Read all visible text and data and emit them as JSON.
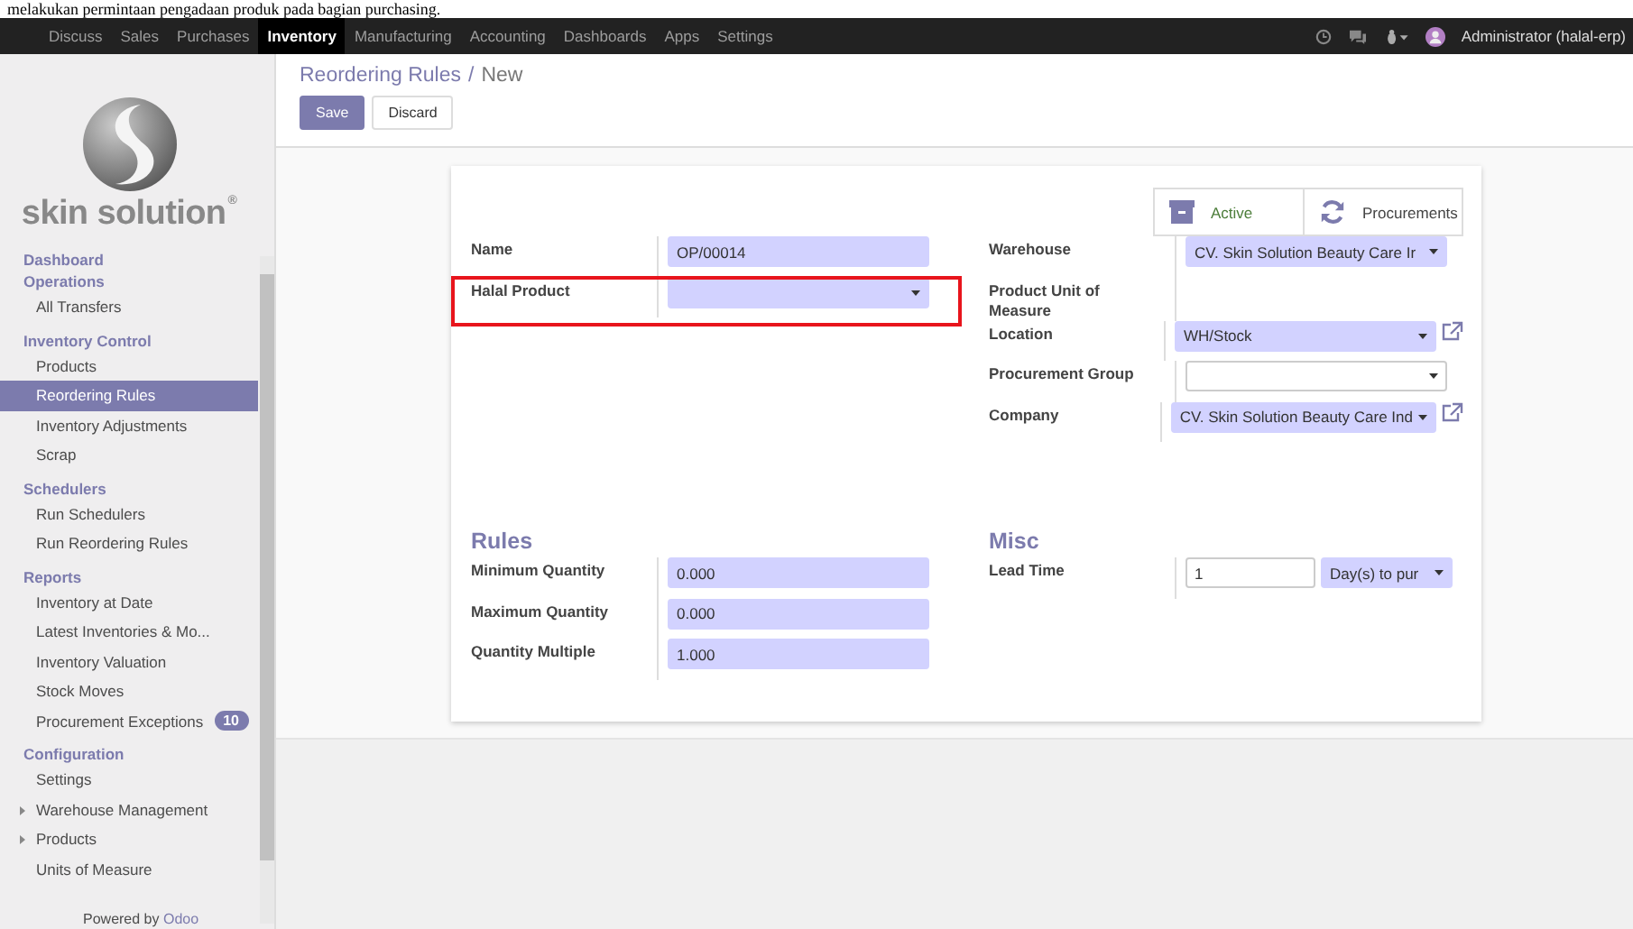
{
  "caption": "melakukan permintaan pengadaan produk pada bagian purchasing.",
  "navbar": {
    "menus": [
      {
        "label": "Discuss",
        "selected": false
      },
      {
        "label": "Sales",
        "selected": false
      },
      {
        "label": "Purchases",
        "selected": false
      },
      {
        "label": "Inventory",
        "selected": true
      },
      {
        "label": "Manufacturing",
        "selected": false
      },
      {
        "label": "Accounting",
        "selected": false
      },
      {
        "label": "Dashboards",
        "selected": false
      },
      {
        "label": "Apps",
        "selected": false
      },
      {
        "label": "Settings",
        "selected": false
      }
    ],
    "user": "Administrator (halal-erp)"
  },
  "sidebar": {
    "logo_text": "skin solution",
    "logo_mark": "®",
    "sections": [
      {
        "title": "Dashboard"
      },
      {
        "title": "Operations",
        "items": [
          {
            "label": "All Transfers",
            "selected": false
          }
        ]
      },
      {
        "title": "Inventory Control",
        "items": [
          {
            "label": "Products",
            "selected": false
          },
          {
            "label": "Reordering Rules",
            "selected": true
          },
          {
            "label": "Inventory Adjustments",
            "selected": false
          },
          {
            "label": "Scrap",
            "selected": false
          }
        ]
      },
      {
        "title": "Schedulers",
        "items": [
          {
            "label": "Run Schedulers",
            "selected": false
          },
          {
            "label": "Run Reordering Rules",
            "selected": false
          }
        ]
      },
      {
        "title": "Reports",
        "items": [
          {
            "label": "Inventory at Date",
            "selected": false
          },
          {
            "label": "Latest Inventories & Mo...",
            "selected": false
          },
          {
            "label": "Inventory Valuation",
            "selected": false
          },
          {
            "label": "Stock Moves",
            "selected": false
          },
          {
            "label": "Procurement Exceptions",
            "selected": false,
            "badge": "10"
          }
        ]
      },
      {
        "title": "Configuration",
        "items": [
          {
            "label": "Settings",
            "selected": false
          },
          {
            "label": "Warehouse Management",
            "selected": false,
            "expanded": false
          },
          {
            "label": "Products",
            "selected": false,
            "expanded": false
          },
          {
            "label": "Units of Measure",
            "selected": false
          }
        ]
      }
    ],
    "powered_by": "Powered by",
    "powered_link": "Odoo"
  },
  "control_panel": {
    "breadcrumb_parent": "Reordering Rules",
    "breadcrumb_separator": "/",
    "breadcrumb_current": "New",
    "buttons": [
      {
        "kind": "primary",
        "label": "Save"
      },
      {
        "kind": "secondary",
        "label": "Discard"
      }
    ]
  },
  "form": {
    "smart_buttons": [
      {
        "kind": "archive",
        "label": "Active"
      },
      {
        "kind": "refresh",
        "label": "Procurements"
      }
    ],
    "left_fields": [
      {
        "label": "Name",
        "kind": "text",
        "value": "OP/00014",
        "required": true,
        "highlighted": false
      },
      {
        "label": "Halal Product",
        "kind": "select",
        "required": true,
        "highlighted": true
      }
    ],
    "right_fields": [
      {
        "label": "Warehouse",
        "kind": "select",
        "value": "CV. Skin Solution Beauty Care Ir",
        "required": true,
        "external_link": false
      },
      {
        "label": "Product Unit of Measure",
        "kind": "readonly",
        "external_link": false
      },
      {
        "label": "Location",
        "kind": "select",
        "value": "WH/Stock",
        "required": true,
        "external_link": true
      },
      {
        "label": "Procurement Group",
        "kind": "select",
        "required": false,
        "external_link": false
      },
      {
        "label": "Company",
        "kind": "select",
        "value": "CV. Skin Solution Beauty Care Ind",
        "required": true,
        "external_link": true
      }
    ],
    "rules": {
      "title": "Rules",
      "fields": [
        {
          "label": "Minimum Quantity",
          "kind": "text",
          "value": "0.000",
          "required": true
        },
        {
          "label": "Maximum Quantity",
          "kind": "text",
          "value": "0.000",
          "required": true
        },
        {
          "label": "Quantity Multiple",
          "kind": "text",
          "value": "1.000",
          "required": true
        }
      ]
    },
    "misc": {
      "title": "Misc",
      "fields": [
        {
          "label": "Lead Time",
          "kind": "text",
          "value": "1",
          "required": false,
          "unit": "Day(s) to pur"
        }
      ]
    }
  }
}
